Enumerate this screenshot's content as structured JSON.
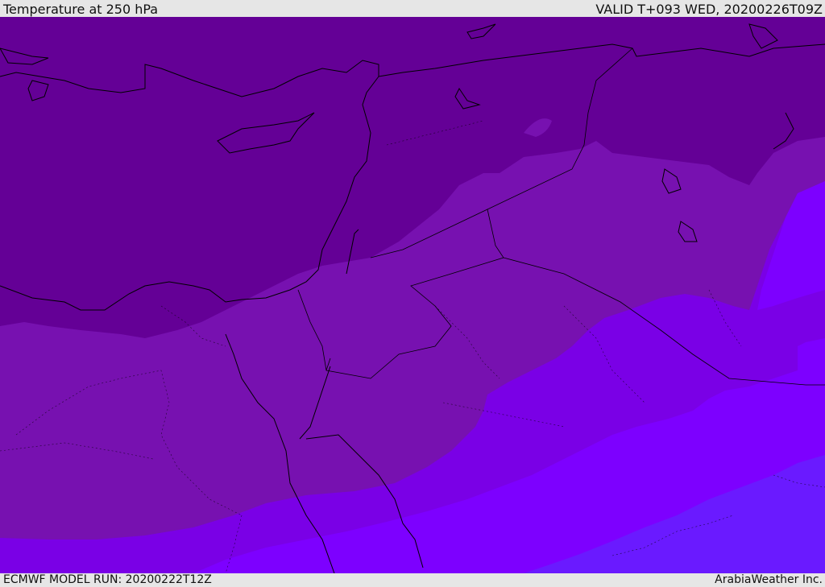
{
  "header": {
    "title": "Temperature at 250 hPa",
    "valid": "VALID T+093 WED, 20200226T09Z"
  },
  "footer": {
    "model_run": "ECMWF MODEL RUN: 20200222T12Z",
    "credit": "ArabiaWeather Inc."
  },
  "map": {
    "colors": {
      "band_coldest": "#640096",
      "band_2": "#7711b0",
      "band_3": "#7a00e6",
      "band_4": "#7d00ff",
      "band_warmest": "#6a1aff",
      "outline": "#000000"
    }
  }
}
